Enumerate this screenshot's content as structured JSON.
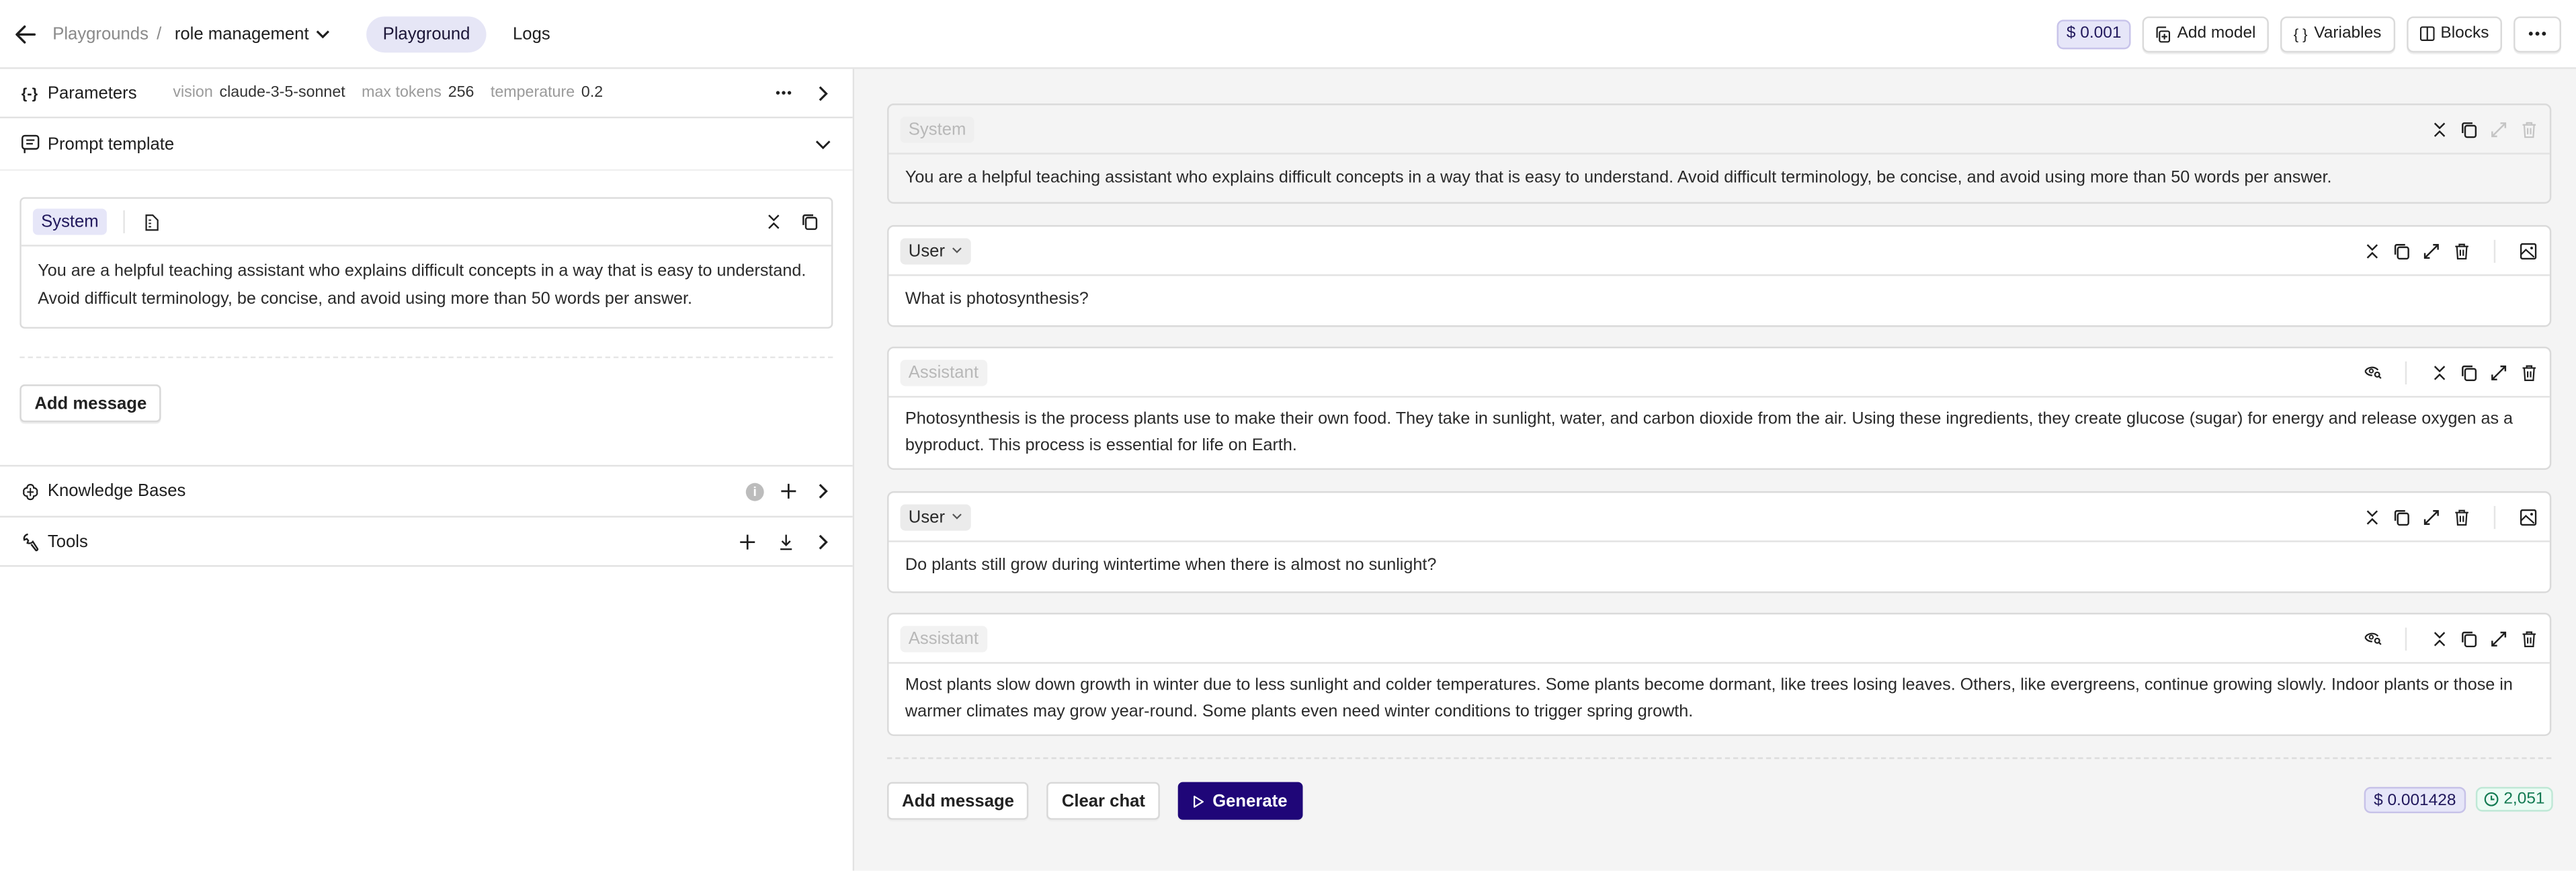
{
  "topbar": {
    "breadcrumb_root": "Playgrounds",
    "breadcrumb_sep": "/",
    "project": "role management",
    "tabs": [
      {
        "label": "Playground",
        "active": true
      },
      {
        "label": "Logs",
        "active": false
      }
    ],
    "cost": "$ 0.001",
    "add_model": "Add model",
    "variables": "Variables",
    "blocks": "Blocks"
  },
  "parameters": {
    "title": "Parameters",
    "items": [
      {
        "key": "vision",
        "value": "claude-3-5-sonnet"
      },
      {
        "key": "max tokens",
        "value": "256"
      },
      {
        "key": "temperature",
        "value": "0.2"
      }
    ]
  },
  "prompt_template": {
    "title": "Prompt template",
    "system_role": "System",
    "system_text": "You are a helpful teaching assistant who explains difficult concepts in a way that is easy to understand. Avoid difficult terminology, be concise, and avoid using more than 50 words per answer.",
    "add_message": "Add message"
  },
  "knowledge_bases": {
    "title": "Knowledge Bases",
    "info": "i"
  },
  "tools": {
    "title": "Tools"
  },
  "chat": {
    "messages": [
      {
        "role": "System",
        "text": "You are a helpful teaching assistant who explains difficult concepts in a way that is easy to understand. Avoid difficult terminology, be concise, and avoid using more than 50 words per answer."
      },
      {
        "role": "User",
        "text": "What is photosynthesis?"
      },
      {
        "role": "Assistant",
        "text": "Photosynthesis is the process plants use to make their own food. They take in sunlight, water, and carbon dioxide from the air. Using these ingredients, they create glucose (sugar) for energy and release oxygen as a byproduct. This process is essential for life on Earth."
      },
      {
        "role": "User",
        "text": "Do plants still grow during wintertime when there is almost no sunlight?"
      },
      {
        "role": "Assistant",
        "text": "Most plants slow down growth in winter due to less sunlight and colder temperatures. Some plants become dormant, like trees losing leaves. Others, like evergreens, continue growing slowly. Indoor plants or those in warmer climates may grow year-round. Some plants even need winter conditions to trigger spring growth."
      }
    ],
    "add_message": "Add message",
    "clear_chat": "Clear chat",
    "generate": "Generate",
    "total_cost": "$ 0.001428",
    "tokens": "2,051"
  },
  "colors": {
    "accent": "#1f0678",
    "accent_bg": "#e6e6f8",
    "token_green": "#137a52"
  }
}
